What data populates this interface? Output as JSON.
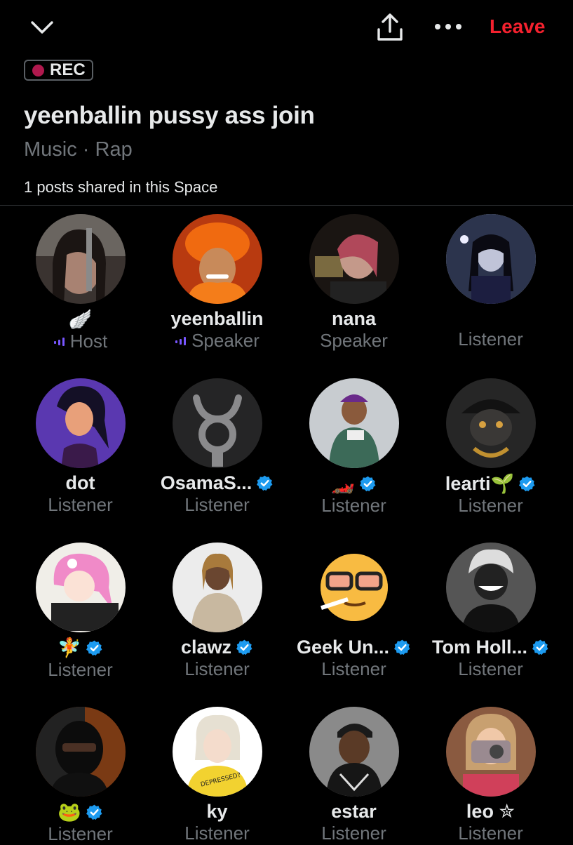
{
  "header": {
    "leave_label": "Leave",
    "icons": [
      "chevron-down-icon",
      "share-icon",
      "more-icon"
    ]
  },
  "space": {
    "rec_label": "REC",
    "title": "yeenballin pussy ass join",
    "topic": "Music · Rap",
    "posts_shared": "1 posts shared in this Space"
  },
  "colors": {
    "background": "#000000",
    "primary_text": "#e7e9ea",
    "secondary_text": "#71767b",
    "leave": "#f4212e",
    "rec_dot": "#b0194e",
    "verified": "#1d9bf0",
    "speaking_indicator": "#7856ff"
  },
  "participants": [
    {
      "name": "🪽",
      "role": "Host",
      "verified": false,
      "speaking": true
    },
    {
      "name": "yeenballin",
      "role": "Speaker",
      "verified": false,
      "speaking": true
    },
    {
      "name": "nana",
      "role": "Speaker",
      "verified": false,
      "speaking": false
    },
    {
      "name": "",
      "role": "Listener",
      "verified": false,
      "speaking": false
    },
    {
      "name": "dot",
      "role": "Listener",
      "verified": false,
      "speaking": false
    },
    {
      "name": "OsamaS...",
      "role": "Listener",
      "verified": true,
      "speaking": false
    },
    {
      "name": "🏎️",
      "role": "Listener",
      "verified": true,
      "speaking": false
    },
    {
      "name": "learti🌱",
      "role": "Listener",
      "verified": true,
      "speaking": false
    },
    {
      "name": "🧚",
      "role": "Listener",
      "verified": true,
      "speaking": false
    },
    {
      "name": "clawz",
      "role": "Listener",
      "verified": true,
      "speaking": false
    },
    {
      "name": "Geek Un...",
      "role": "Listener",
      "verified": true,
      "speaking": false
    },
    {
      "name": "Tom Holl...",
      "role": "Listener",
      "verified": true,
      "speaking": false
    },
    {
      "name": "🐸",
      "role": "Listener",
      "verified": true,
      "speaking": false
    },
    {
      "name": "ky",
      "role": "Listener",
      "verified": false,
      "speaking": false
    },
    {
      "name": "estar",
      "role": "Listener",
      "verified": false,
      "speaking": false
    },
    {
      "name": "leo ✮",
      "role": "Listener",
      "verified": false,
      "speaking": false
    }
  ]
}
